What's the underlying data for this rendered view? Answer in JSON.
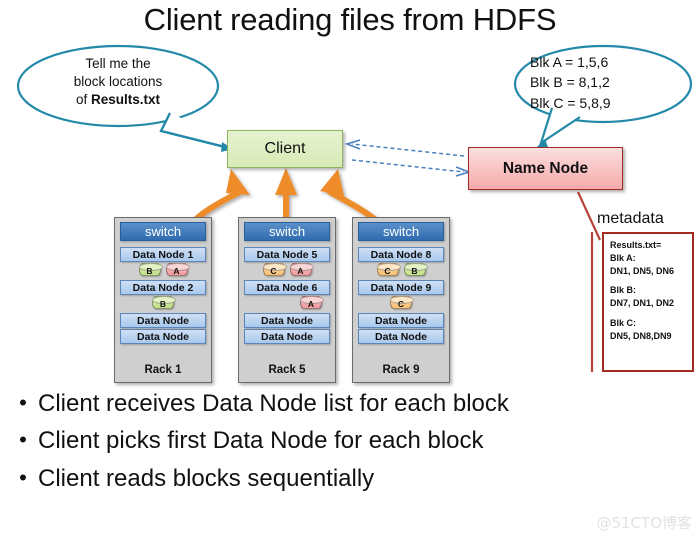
{
  "title": "Client reading files from HDFS",
  "bubbles": {
    "left": {
      "line1": "Tell me the",
      "line2": "block locations",
      "line3_prefix": "of ",
      "line3_bold": "Results.txt"
    },
    "right": {
      "line1": "Blk A = 1,5,6",
      "line2": "Blk B = 8,1,2",
      "line3": "Blk C = 5,8,9"
    }
  },
  "client": {
    "label": "Client"
  },
  "namenode": {
    "label": "Name Node"
  },
  "racks": [
    {
      "id": "rack-0",
      "switch_label": "switch",
      "rack_label": "Rack 1",
      "nodes": [
        {
          "label": "Data Node 1",
          "blocks": [
            {
              "letter": "B",
              "color": "green"
            },
            {
              "letter": "A",
              "color": "red"
            }
          ],
          "align": "center"
        },
        {
          "label": "Data Node 2",
          "blocks": [
            {
              "letter": "B",
              "color": "green"
            }
          ],
          "align": "center"
        }
      ],
      "plain_nodes": [
        "Data Node",
        "Data Node"
      ]
    },
    {
      "id": "rack-1",
      "switch_label": "switch",
      "rack_label": "Rack 5",
      "nodes": [
        {
          "label": "Data Node 5",
          "blocks": [
            {
              "letter": "C",
              "color": "orange"
            },
            {
              "letter": "A",
              "color": "red"
            }
          ],
          "align": "center"
        },
        {
          "label": "Data Node 6",
          "blocks": [
            {
              "letter": "A",
              "color": "red"
            }
          ],
          "align": "right"
        }
      ],
      "plain_nodes": [
        "Data Node",
        "Data Node"
      ]
    },
    {
      "id": "rack-2",
      "switch_label": "switch",
      "rack_label": "Rack 9",
      "nodes": [
        {
          "label": "Data Node 8",
          "blocks": [
            {
              "letter": "C",
              "color": "orange"
            },
            {
              "letter": "B",
              "color": "green"
            }
          ],
          "align": "center"
        },
        {
          "label": "Data Node 9",
          "blocks": [
            {
              "letter": "C",
              "color": "orange"
            }
          ],
          "align": "center"
        }
      ],
      "plain_nodes": [
        "Data Node",
        "Data Node"
      ]
    }
  ],
  "metadata": {
    "title": "metadata",
    "lines": [
      "Results.txt=",
      "Blk A:",
      "DN1, DN5, DN6",
      "",
      "Blk B:",
      "DN7, DN1, DN2",
      "",
      "Blk C:",
      "DN5, DN8,DN9"
    ]
  },
  "bullets": [
    "Client receives Data Node list for each block",
    "Client picks first Data Node for each block",
    "Client reads blocks sequentially"
  ],
  "watermark": "@51CTO博客",
  "colors": {
    "bubble_outline": "#2389a8",
    "client_fill": "#d7eab6",
    "namenode_fill": "#f6a9a9",
    "namenode_border": "#9e2b25",
    "switch_fill": "#2f6cb0",
    "datanode_fill": "#a9c8ec",
    "rack_fill": "#cfcfcf",
    "arrow_orange": "#ef8c2b",
    "arrow_dashed_blue": "#4a7fbf",
    "metadata_border": "#a32b21",
    "blk_green": "#c2e089",
    "blk_red": "#f29b9b",
    "blk_orange": "#f8c273"
  }
}
